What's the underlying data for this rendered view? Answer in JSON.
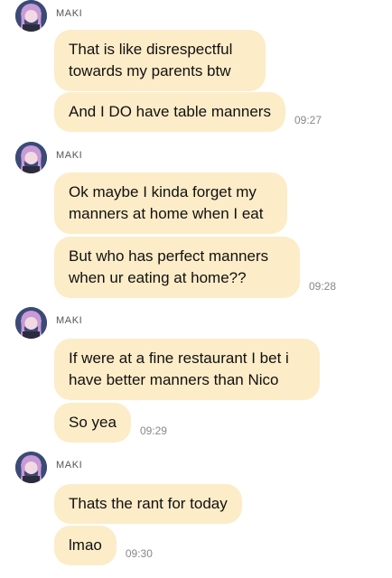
{
  "chat": {
    "groups": [
      {
        "sender": "MAKI",
        "messages": [
          {
            "text": "That is like disrespectful towards my parents btw",
            "time": ""
          },
          {
            "text": "And I DO have table manners",
            "time": "09:27"
          }
        ]
      },
      {
        "sender": "MAKI",
        "messages": [
          {
            "text": "Ok maybe I kinda forget my manners at home when I eat",
            "time": ""
          },
          {
            "text": "But who has perfect manners when ur eating at home??",
            "time": "09:28"
          }
        ]
      },
      {
        "sender": "MAKI",
        "messages": [
          {
            "text": "If were at a fine restaurant I bet i have better manners than Nico",
            "time": ""
          },
          {
            "text": "So yea",
            "time": "09:29"
          }
        ]
      },
      {
        "sender": "MAKI",
        "messages": [
          {
            "text": "Thats the rant for today",
            "time": ""
          },
          {
            "text": "lmao",
            "time": "09:30"
          }
        ]
      }
    ]
  },
  "theme": {
    "bubble_color": "#fcecc8",
    "avatar_hair_color": "#c79bd6",
    "avatar_bg_color": "#3c4a78"
  }
}
